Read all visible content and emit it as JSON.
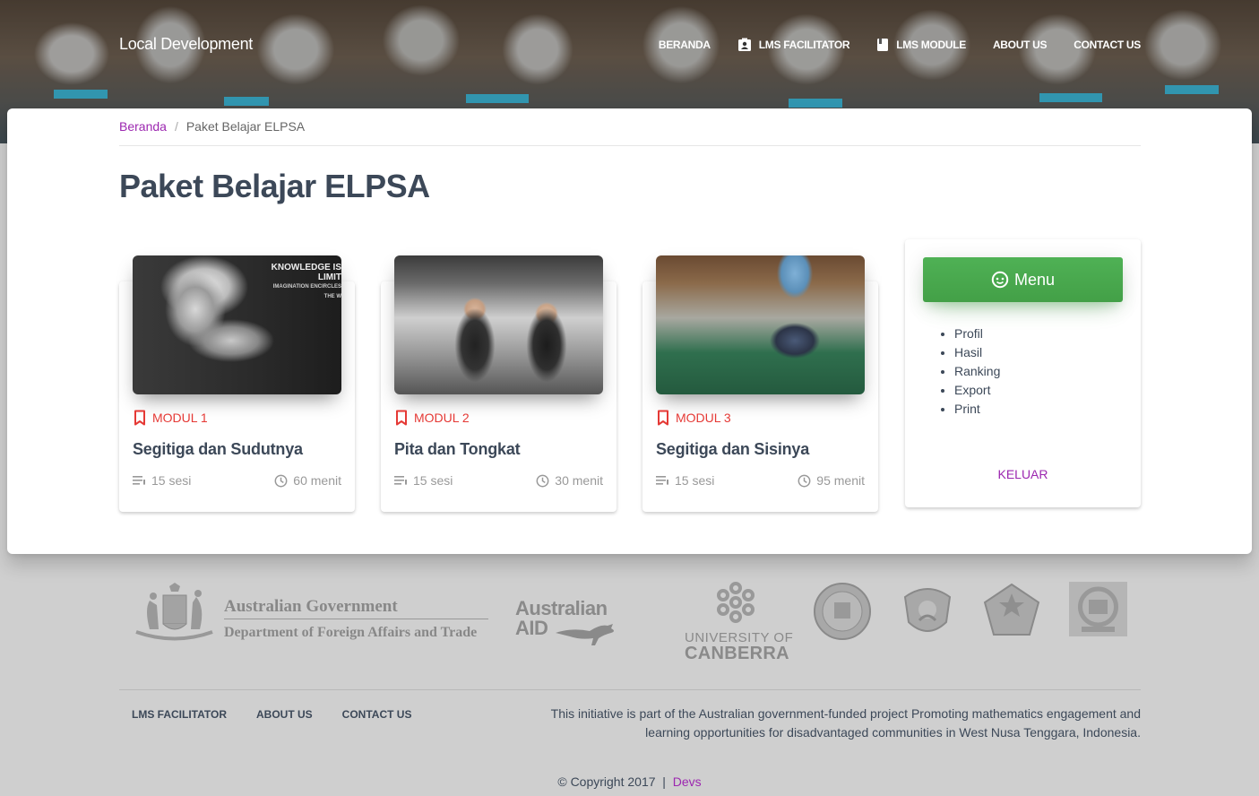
{
  "header": {
    "brand": "Local Development",
    "nav": [
      {
        "label": "BERANDA",
        "icon": ""
      },
      {
        "label": "LMS FACILITATOR",
        "icon": "contact-badge-icon"
      },
      {
        "label": "LMS MODULE",
        "icon": "book-icon"
      },
      {
        "label": "ABOUT US",
        "icon": ""
      },
      {
        "label": "CONTACT US",
        "icon": ""
      }
    ]
  },
  "breadcrumb": {
    "home": "Beranda",
    "separator": "/",
    "current": "Paket Belajar ELPSA"
  },
  "page_title": "Paket Belajar ELPSA",
  "modules": [
    {
      "label": "MODUL 1",
      "title": "Segitiga dan Sudutnya",
      "sessions": "15 sesi",
      "duration": "60 menit"
    },
    {
      "label": "MODUL 2",
      "title": "Pita dan Tongkat",
      "sessions": "15 sesi",
      "duration": "30 menit"
    },
    {
      "label": "MODUL 3",
      "title": "Segitiga dan Sisinya",
      "sessions": "15 sesi",
      "duration": "95 menit"
    }
  ],
  "module1_image_text": {
    "line1": "KNOWLEDGE IS LIMIT",
    "line2": "IMAGINATION ENCIRCLES THE W"
  },
  "menu": {
    "button": "Menu",
    "items": [
      "Profil",
      "Hasil",
      "Ranking",
      "Export",
      "Print"
    ],
    "logout": "KELUAR"
  },
  "partners": {
    "ag_line1": "Australian Government",
    "ag_line2": "Department of Foreign Affairs and Trade",
    "aid_line1": "Australian",
    "aid_line2": "AID",
    "uc_line1": "UNIVERSITY OF",
    "uc_line2": "CANBERRA"
  },
  "footer": {
    "nav": [
      "LMS FACILITATOR",
      "ABOUT US",
      "CONTACT US"
    ],
    "description": "This initiative is part of the Australian government-funded project Promoting mathematics engagement and learning opportunities for disadvantaged communities in West Nusa Tenggara, Indonesia.",
    "copyright": "© Copyright 2017",
    "separator": "|",
    "devs": "Devs"
  },
  "colors": {
    "accent": "#9c27b0",
    "module_label": "#e53935",
    "menu_button": "#43a047"
  }
}
